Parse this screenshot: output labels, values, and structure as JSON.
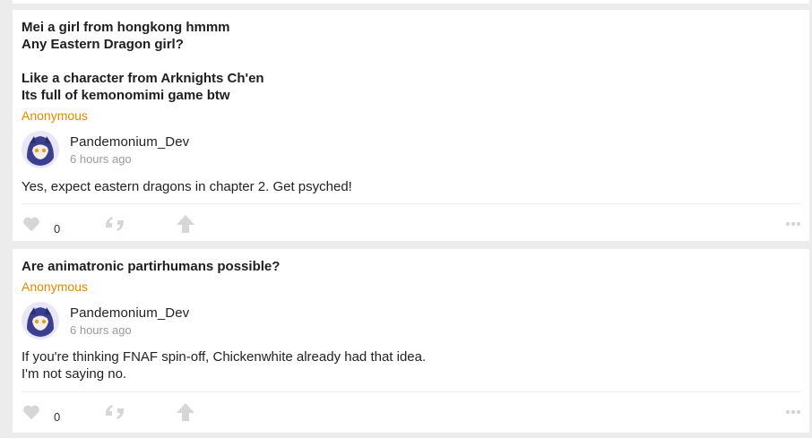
{
  "posts": [
    {
      "question": "Mei a girl from hongkong hmmm\nAny Eastern Dragon girl?\n\nLike a character from Arknights Ch'en\nIts full of kemonomimi game btw",
      "asker": "Anonymous",
      "author": "Pandemonium_Dev",
      "time": "6 hours ago",
      "answer": "Yes, expect eastern dragons in chapter 2. Get psyched!",
      "likes": "0"
    },
    {
      "question": "Are animatronic partirhumans possible?",
      "asker": "Anonymous",
      "author": "Pandemonium_Dev",
      "time": "6 hours ago",
      "answer": "If you're thinking FNAF spin-off, Chickenwhite already had that idea.\nI'm not saying no.",
      "likes": "0"
    }
  ],
  "icons": {
    "like": "heart-icon",
    "comment": "quote-icon",
    "share": "share-arrow-icon",
    "more": "more-dots-icon"
  },
  "colors": {
    "asker": "#e08a00",
    "icon": "#d6d6d6",
    "background": "#ececec"
  }
}
